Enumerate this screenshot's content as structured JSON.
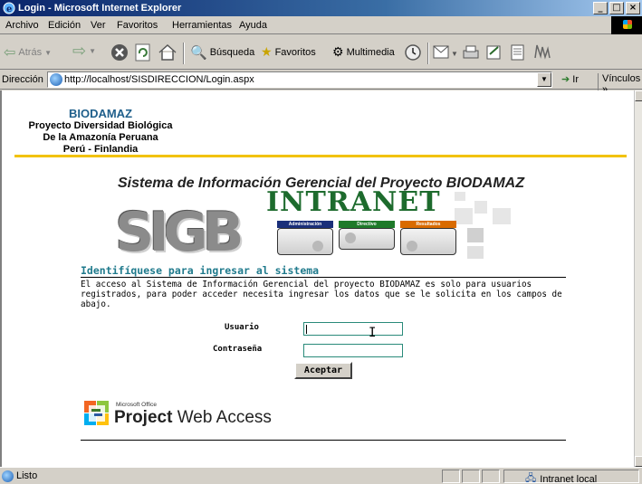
{
  "window": {
    "title": "Login - Microsoft Internet Explorer",
    "controls": [
      "_",
      "□",
      "×"
    ]
  },
  "menu": [
    "Archivo",
    "Edición",
    "Ver",
    "Favoritos",
    "Herramientas",
    "Ayuda"
  ],
  "toolbar": {
    "back": "Atrás",
    "search": "Búsqueda",
    "favorites": "Favoritos",
    "media": "Multimedia"
  },
  "address": {
    "label": "Dirección",
    "url": "http://localhost/SISDIRECCION/Login.aspx",
    "go": "Ir",
    "links": "Vínculos"
  },
  "org": {
    "brand": "BIODAMAZ",
    "line1": "Proyecto Diversidad Biológica",
    "line2": "De la Amazonía Peruana",
    "line3": "Perú - Finlandia"
  },
  "banner": {
    "system_title": "Sistema de Información Gerencial del Proyecto BIODAMAZ",
    "sigb": "SIGB",
    "intranet": "INTRANET",
    "modules": [
      {
        "label": "Administración",
        "color": "#1a2f7a"
      },
      {
        "label": "Directivo",
        "color": "#1f7a2a"
      },
      {
        "label": "Resultados",
        "color": "#d96b00"
      }
    ]
  },
  "login": {
    "heading": "Identifíquese para ingresar al sistema",
    "intro": "El acceso al Sistema de Información Gerencial del proyecto BIODAMAZ es solo para usuarios registrados, para poder acceder necesita ingresar los datos que se le solicita en los campos de abajo.",
    "user_label": "Usuario",
    "user_value": "",
    "password_label": "Contraseña",
    "password_value": "",
    "submit": "Aceptar"
  },
  "footer_logo": {
    "small": "Microsoft Office",
    "main_bold": "Project",
    "main_rest": " Web Access"
  },
  "status": {
    "text": "Listo",
    "zone": "Intranet local"
  }
}
